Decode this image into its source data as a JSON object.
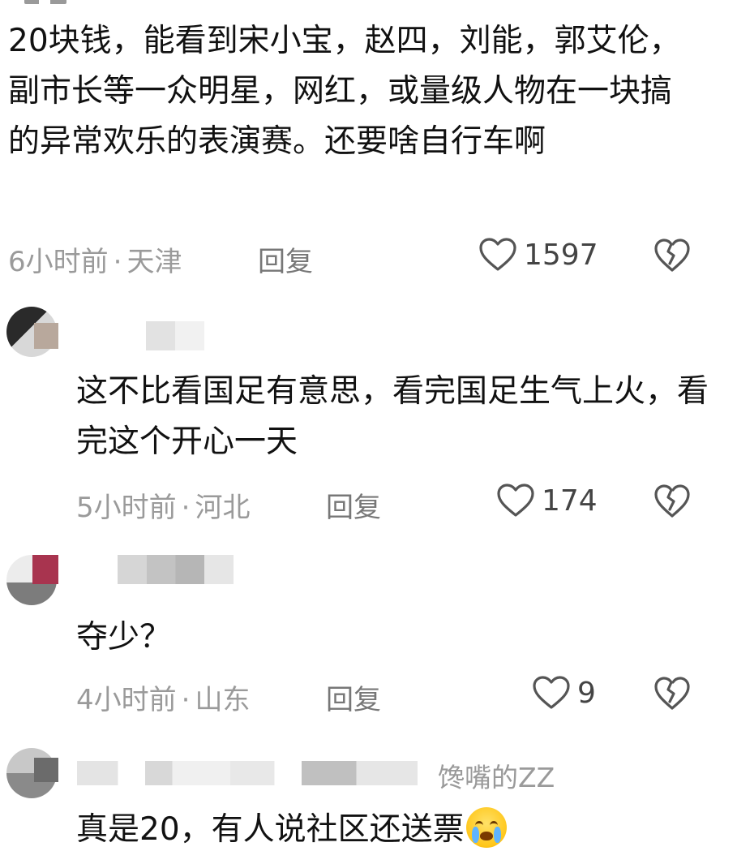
{
  "comments": [
    {
      "text": "20块钱，能看到宋小宝，赵四，刘能，郭艾伦，副市长等一众明星，网红，或量级人物在一块搞的异常欢乐的表演赛。还要啥自行车啊",
      "time": "6小时前",
      "location": "天津",
      "reply_label": "回复",
      "likes": "1597"
    },
    {
      "text": "这不比看国足有意思，看完国足生气上火，看完这个开心一天",
      "time": "5小时前",
      "location": "河北",
      "reply_label": "回复",
      "likes": "174"
    },
    {
      "text": "夺少？",
      "time": "4小时前",
      "location": "山东",
      "reply_label": "回复",
      "likes": "9"
    },
    {
      "username_visible": "馋嘴的ZZ",
      "text": "真是20，有人说社区还送票",
      "emoji": "crying-laughing-emoji"
    }
  ],
  "meta_separator": "·",
  "icons": {
    "like": "heart-outline-icon",
    "dislike": "broken-heart-icon"
  },
  "colors": {
    "text": "#111111",
    "meta": "#9a9a9a",
    "icon": "#555555"
  }
}
